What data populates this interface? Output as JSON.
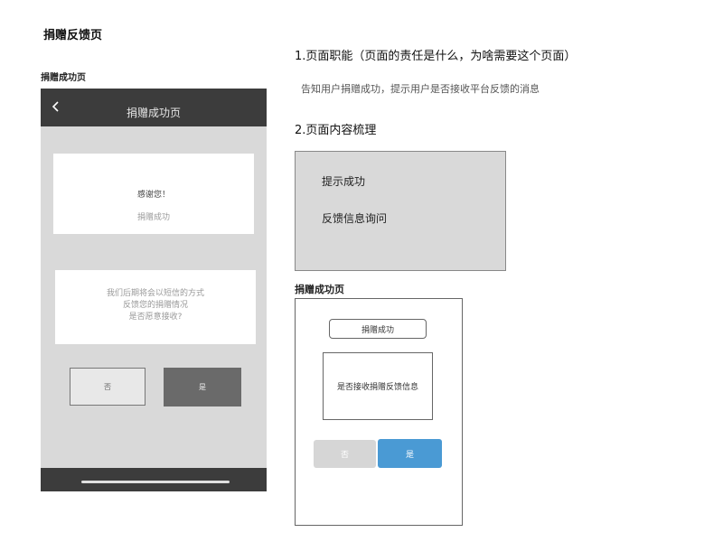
{
  "page_title": "捐赠反馈页",
  "mockup": {
    "label": "捐赠成功页",
    "nav_title": "捐赠成功页",
    "back_icon": "chevron-left-icon",
    "card1": {
      "thanks": "感谢您！",
      "status": "捐赠成功"
    },
    "card2": {
      "lines": [
        "我们后期将会以短信的方式",
        "反馈您的捐赠情况",
        "是否愿意接收?"
      ]
    },
    "buttons": {
      "no": "否",
      "yes": "是"
    },
    "colors": {
      "bar": "#3c3c3c",
      "screen": "#d9d9d9",
      "yes": "#6a6a6a"
    }
  },
  "section1": {
    "heading": "1.页面职能（页面的责任是什么，为啥需要这个页面）",
    "description": "告知用户捐赠成功，提示用户是否接收平台反馈的消息"
  },
  "section2": {
    "heading": "2.页面内容梳理",
    "items": [
      "提示成功",
      "反馈信息询问"
    ]
  },
  "wireframe": {
    "label": "捐赠成功页",
    "pill": "捐赠成功",
    "box_text": "是否接收捐赠反馈信息",
    "no": "否",
    "yes": "是",
    "colors": {
      "yes": "#4a9ad4",
      "no": "#d6d6d6"
    }
  }
}
